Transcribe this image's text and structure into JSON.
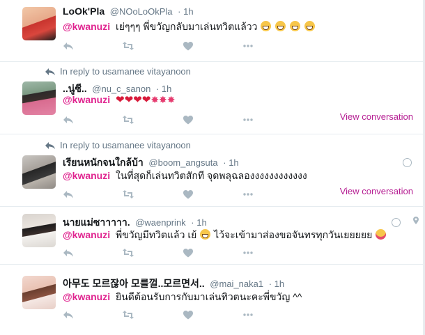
{
  "accent_color": "#e0248f",
  "tweets": [
    {
      "name": "LoOk'Pla",
      "handle": "@NOoLoOkPla",
      "time": "1h",
      "mention": "@kwanuzi",
      "text": "เย่ๆๆๆ พี่ขวัญกลับมาเล่นทวิตแล้วว",
      "emojis": [
        "grinning-face",
        "grinning-face",
        "grinning-face",
        "grinning-face"
      ]
    },
    {
      "reply_to": "In reply to usamanee vitayanoon",
      "name": "..นู่ซี..",
      "handle": "@nu_c_sanon",
      "time": "1h",
      "mention": "@kwanuzi",
      "emojis": [
        "heart",
        "heart",
        "heart",
        "heart",
        "party-popper",
        "party-popper",
        "party-popper"
      ],
      "view_conversation": "View conversation"
    },
    {
      "reply_to": "In reply to usamanee vitayanoon",
      "name": "เรียนหนักจนใกล้บ้า",
      "handle": "@boom_angsuta",
      "time": "1h",
      "mention": "@kwanuzi",
      "text": "ในที่สุดก็เล่นทวิตสักที จุดพลุฉลองงงงงงงงงงงง",
      "view_conversation": "View conversation"
    },
    {
      "name": "นายแม่ซาาาาา.",
      "handle": "@waenprink",
      "time": "1h",
      "mention": "@kwanuzi",
      "text": "พี่ขวัญมีทวิตแล้ว เย้",
      "text2": "ไว้จะเข้ามาส่องขอจันทรทุกวันเยยยยย",
      "emojis": [
        "grinning-face",
        "winking-face-tongue"
      ]
    },
    {
      "name": "아무도 모르잖아 모를껄..모르면서..",
      "handle": "@mai_naka1",
      "time": "1h",
      "mention": "@kwanuzi",
      "text": "ยินดีต้อนรับการกับมาเล่นทิวตนะคะพี่ขวัญ ^^"
    }
  ],
  "action_icons": [
    "reply-icon",
    "retweet-icon",
    "like-icon",
    "more-icon"
  ]
}
